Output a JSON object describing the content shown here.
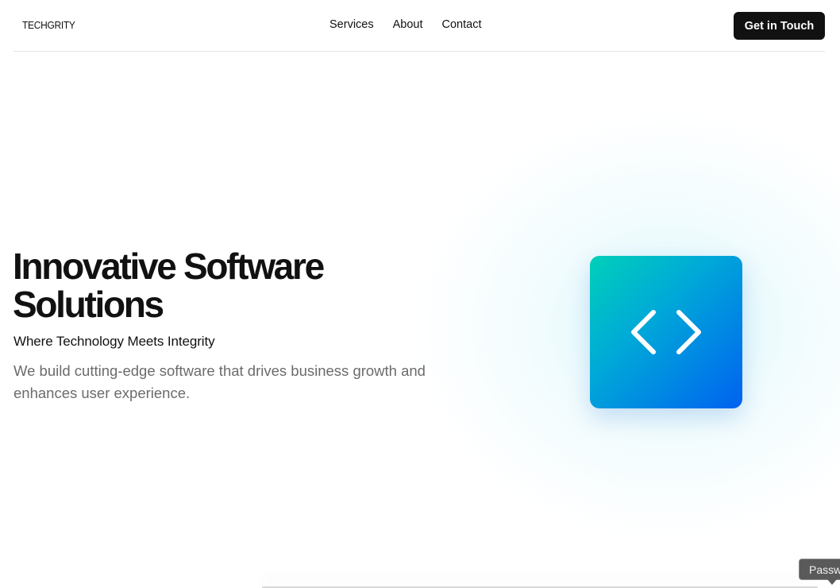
{
  "header": {
    "logo": "TECHGRITY",
    "nav": [
      {
        "label": "Services"
      },
      {
        "label": "About"
      },
      {
        "label": "Contact"
      }
    ],
    "cta_label": "Get in Touch"
  },
  "hero": {
    "title": "Innovative Software Solutions",
    "subtitle": "Where Technology Meets Integrity",
    "description": "We build cutting-edge software that drives business growth and enhances user experience.",
    "illustration_icon": "code-brackets-icon"
  },
  "tooltip": {
    "text": "Passw"
  },
  "colors": {
    "accent_start": "#00d0b9",
    "accent_end": "#0062f0",
    "button_bg": "#111111",
    "muted_text": "#6b6b6b"
  }
}
